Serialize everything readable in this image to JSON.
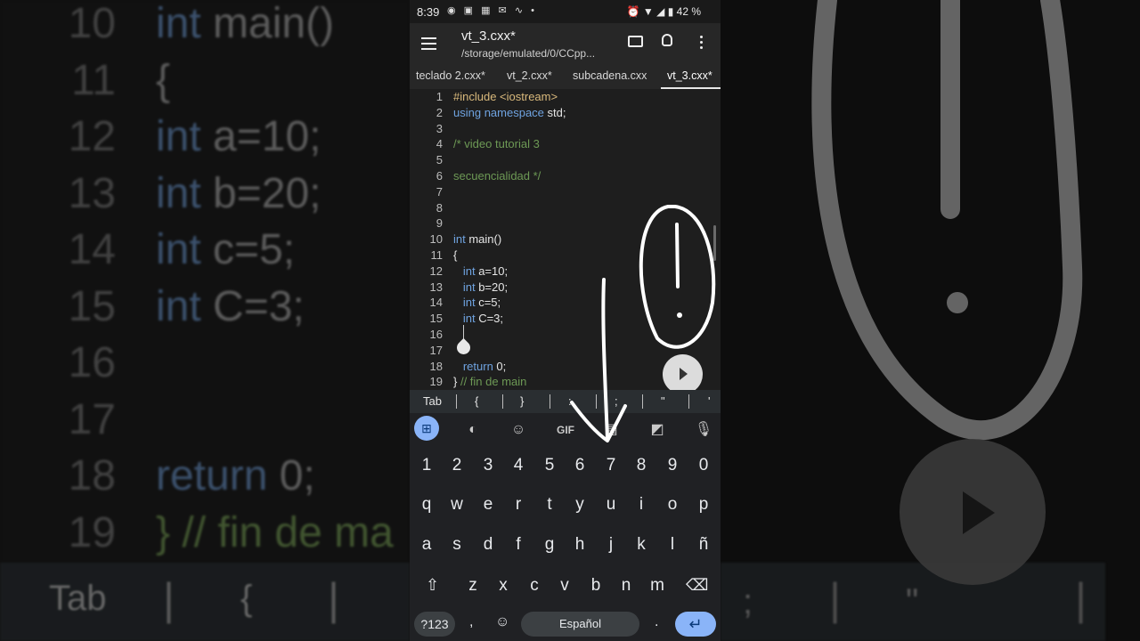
{
  "status_bar": {
    "time": "8:39",
    "battery": "42 %"
  },
  "app_bar": {
    "title": "vt_3.cxx*",
    "subtitle": "/storage/emulated/0/CCpp..."
  },
  "tabs": [
    {
      "label": "teclado 2.cxx*"
    },
    {
      "label": "vt_2.cxx*"
    },
    {
      "label": "subcadena.cxx"
    },
    {
      "label": "vt_3.cxx*"
    }
  ],
  "editor": {
    "lines": [
      {
        "n": "1",
        "text": "#include <iostream>"
      },
      {
        "n": "2",
        "text": "using namespace std;"
      },
      {
        "n": "3",
        "text": ""
      },
      {
        "n": "4",
        "text": "/* video tutorial 3"
      },
      {
        "n": "5",
        "text": ""
      },
      {
        "n": "6",
        "text": "secuencialidad */"
      },
      {
        "n": "7",
        "text": ""
      },
      {
        "n": "8",
        "text": ""
      },
      {
        "n": "9",
        "text": ""
      },
      {
        "n": "10",
        "text": "int main()"
      },
      {
        "n": "11",
        "text": "{"
      },
      {
        "n": "12",
        "text": "   int a=10;"
      },
      {
        "n": "13",
        "text": "   int b=20;"
      },
      {
        "n": "14",
        "text": "   int c=5;"
      },
      {
        "n": "15",
        "text": "   int C=3;"
      },
      {
        "n": "16",
        "text": ""
      },
      {
        "n": "17",
        "text": ""
      },
      {
        "n": "18",
        "text": "   return 0;"
      },
      {
        "n": "19",
        "text": "} // fin de main"
      }
    ]
  },
  "symbol_bar": [
    "Tab",
    "{",
    "}",
    ":",
    ";",
    "\"",
    "'"
  ],
  "keyboard": {
    "numbers": [
      "1",
      "2",
      "3",
      "4",
      "5",
      "6",
      "7",
      "8",
      "9",
      "0"
    ],
    "row1": [
      "q",
      "w",
      "e",
      "r",
      "t",
      "y",
      "u",
      "i",
      "o",
      "p"
    ],
    "row2": [
      "a",
      "s",
      "d",
      "f",
      "g",
      "h",
      "j",
      "k",
      "l",
      "ñ"
    ],
    "row3": [
      "z",
      "x",
      "c",
      "v",
      "b",
      "n",
      "m"
    ],
    "symbols_key": "?123",
    "comma": ",",
    "period": ".",
    "space_label": "Español",
    "toolbar_gif": "GIF"
  },
  "background": {
    "lines": [
      {
        "n": "10",
        "text": "int main()"
      },
      {
        "n": "11",
        "text": "{"
      },
      {
        "n": "12",
        "text": "  int a=10;"
      },
      {
        "n": "13",
        "text": "  int b=20;"
      },
      {
        "n": "14",
        "text": "  int c=5;"
      },
      {
        "n": "15",
        "text": "  int C=3;"
      },
      {
        "n": "16",
        "text": ""
      },
      {
        "n": "17",
        "text": ""
      },
      {
        "n": "18",
        "text": "  return 0;"
      },
      {
        "n": "19",
        "text": "} // fin de ma"
      }
    ],
    "tab_label": "Tab",
    "brace_label": "{"
  },
  "colors": {
    "keyword": "#6fa3e0",
    "comment": "#6d9955",
    "accent": "#8ab4f8"
  }
}
